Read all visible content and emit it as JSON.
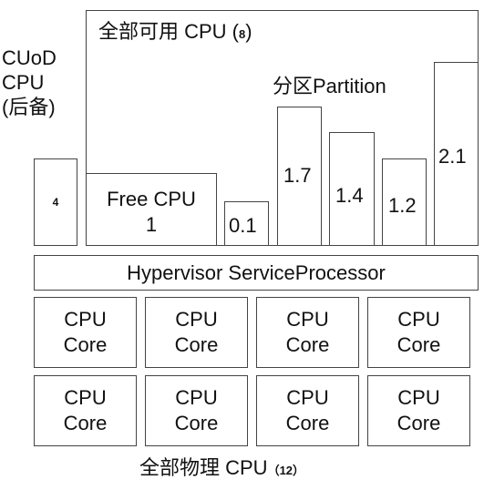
{
  "cuod": {
    "label_lines": [
      "CUoD",
      "CPU",
      "(后备)"
    ],
    "value": "4"
  },
  "available": {
    "title": "全部可用 CPU (",
    "count": "8",
    "title_close": ")",
    "free_cpu": {
      "label": "Free CPU",
      "value": "1"
    },
    "partition_label": "分区Partition",
    "partitions": [
      {
        "value": "0.1"
      },
      {
        "value": "1.7"
      },
      {
        "value": "1.4"
      },
      {
        "value": "1.2"
      },
      {
        "value": "2.1"
      }
    ]
  },
  "hypervisor": {
    "label": "Hypervisor ServiceProcessor"
  },
  "cores": {
    "line1": "CPU",
    "line2": "Core",
    "rows": 2,
    "cols": 4
  },
  "physical": {
    "label": "全部物理 CPU",
    "count": "（12）"
  }
}
